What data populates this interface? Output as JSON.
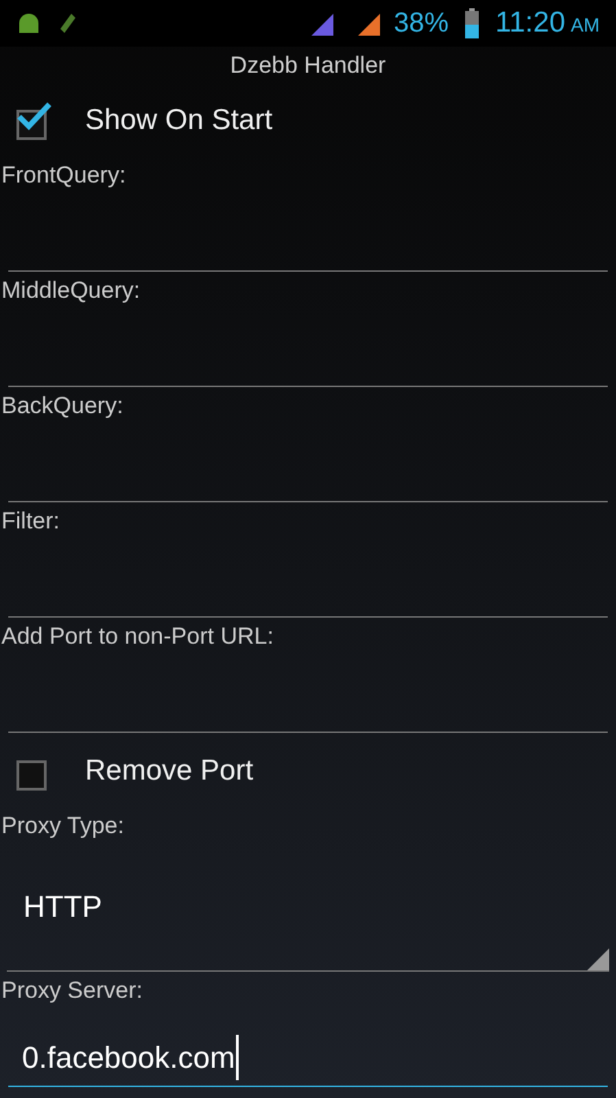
{
  "status_bar": {
    "battery": "38%",
    "time": "11:20",
    "ampm": "AM"
  },
  "window": {
    "title": "Dzebb Handler"
  },
  "form": [
    {
      "kind": "checkbox",
      "label": "Show On Start",
      "checked": true
    },
    {
      "kind": "text_field",
      "label": "FrontQuery:"
    },
    {
      "kind": "text_field",
      "label": "MiddleQuery:"
    },
    {
      "kind": "text_field",
      "label": "BackQuery:"
    },
    {
      "kind": "text_field",
      "label": "Filter:"
    },
    {
      "kind": "text_field",
      "label": "Add Port to non-Port URL:"
    },
    {
      "kind": "checkbox",
      "label": "Remove Port",
      "checked": false
    },
    {
      "kind": "spinner",
      "label": "Proxy Type:",
      "value": "HTTP"
    },
    {
      "kind": "text_field",
      "label": "Proxy Server:",
      "value": "0.facebook.com",
      "focused": true
    }
  ]
}
